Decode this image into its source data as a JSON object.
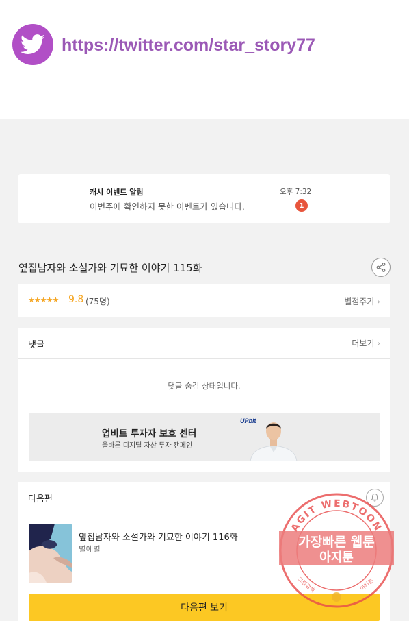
{
  "promo": {
    "icon": "twitter-bird-icon",
    "url": "https://twitter.com/star_story77",
    "color": "#9b59b6"
  },
  "notification": {
    "title": "캐시 이벤트 알림",
    "body": "이번주에 확인하지 못한 이벤트가 있습니다.",
    "time": "오후 7:32",
    "count": "1"
  },
  "episode": {
    "title": "옆집남자와 소설가와 기묘한 이야기 115화"
  },
  "rating": {
    "stars": "★★★★★",
    "score": "9.8",
    "count": "(75명)",
    "rate_link": "별점주기"
  },
  "comments": {
    "title": "댓글",
    "more": "더보기",
    "hidden_message": "댓글 숨김 상태입니다."
  },
  "ad": {
    "title": "업비트 투자자 보호 센터",
    "subtitle": "올바른 디지털 자산 투자 캠페인",
    "logo": "UPbit"
  },
  "next": {
    "title": "다음편",
    "episode_title": "옆집남자와 소설가와 기묘한 이야기 116화",
    "author": "별에별",
    "button": "다음편 보기"
  },
  "watermark": {
    "arc_text": "AGIT WEBTOON",
    "line1": "가장빠른 웹툰",
    "line2": "아지툰",
    "bottom_left": "그림검색",
    "bottom_right": "아지툰"
  },
  "colors": {
    "accent_yellow": "#fcc823",
    "star_orange": "#f5a623",
    "badge_red": "#e8553c",
    "twitter_purple": "#b14fc6"
  }
}
